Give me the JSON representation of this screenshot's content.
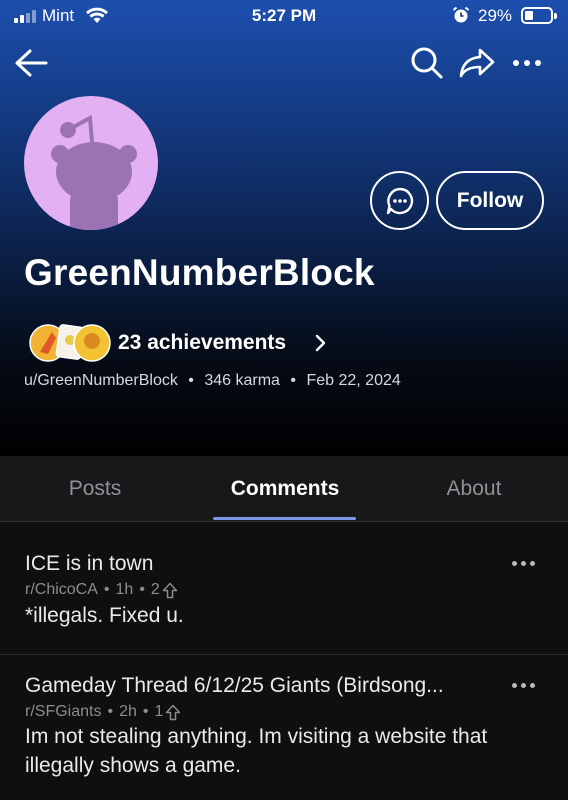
{
  "status_bar": {
    "carrier": "Mint",
    "time": "5:27 PM",
    "battery_percent": "29%",
    "battery_level": 0.29,
    "signal_bars": 2
  },
  "nav": {
    "back_icon": "back-arrow-icon",
    "search_icon": "search-icon",
    "share_icon": "share-icon",
    "more_icon": "more-icon"
  },
  "profile": {
    "display_name": "GreenNumberBlock",
    "avatar_bg_color": "#e3b0f3",
    "follow_label": "Follow",
    "achievements_label": "23 achievements",
    "handle": "u/GreenNumberBlock",
    "karma": "346 karma",
    "joined": "Feb 22, 2024",
    "separator": "•"
  },
  "tabs": [
    {
      "label": "Posts",
      "active": false
    },
    {
      "label": "Comments",
      "active": true
    },
    {
      "label": "About",
      "active": false
    }
  ],
  "comments": [
    {
      "title": "ICE is in town",
      "subreddit": "r/ChicoCA",
      "age": "1h",
      "score": "2",
      "body": "*illegals. Fixed u."
    },
    {
      "title": "Gameday Thread 6/12/25 Giants (Birdsong...",
      "subreddit": "r/SFGiants",
      "age": "2h",
      "score": "1",
      "body": "Im not stealing anything. Im visiting a website that illegally shows a game."
    }
  ],
  "colors": {
    "accent_tab": "#7c96e8",
    "header_top": "#1d4fae",
    "background": "#0f0f10"
  }
}
